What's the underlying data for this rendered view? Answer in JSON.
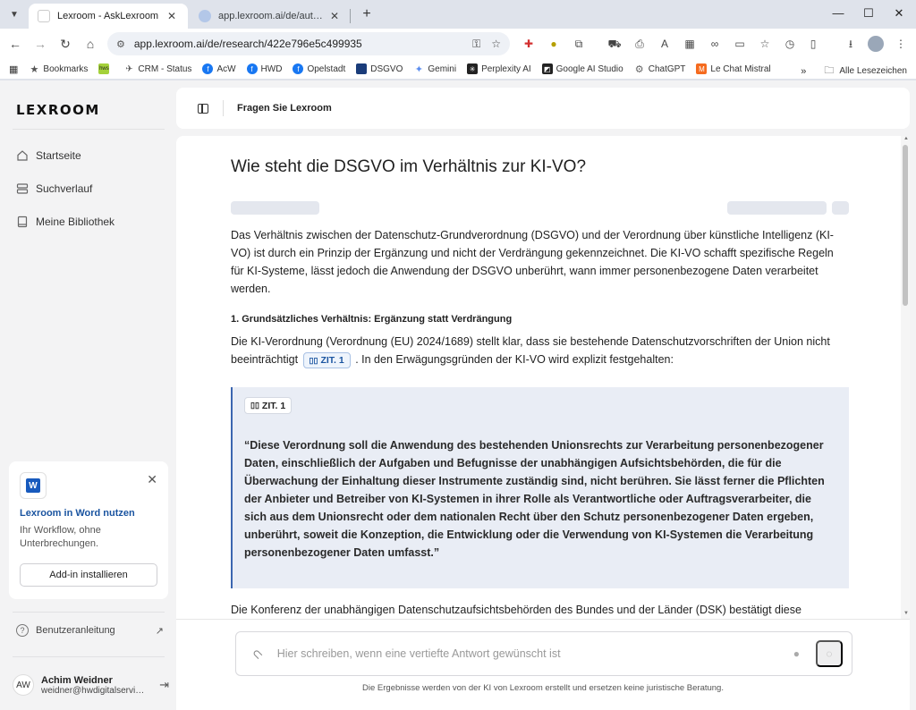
{
  "browser": {
    "tabs": [
      {
        "title": "Lexroom - AskLexroom",
        "close": "✕"
      },
      {
        "title": "app.lexroom.ai/de/auth/sign-up",
        "close": "✕"
      }
    ],
    "url": "app.lexroom.ai/de/research/422e796e5c499935",
    "bookmarks": [
      {
        "label": "Bookmarks",
        "icon": "star-icon",
        "color": "#555"
      },
      {
        "label": "",
        "icon": "hws-icon",
        "color": "#8bc34a"
      },
      {
        "label": "CRM - Status",
        "icon": "crm-icon",
        "color": "#555"
      },
      {
        "label": "AcW",
        "icon": "facebook-icon",
        "color": "#1877f2"
      },
      {
        "label": "HWD",
        "icon": "facebook-icon",
        "color": "#1877f2"
      },
      {
        "label": "Opelstadt",
        "icon": "facebook-icon",
        "color": "#1877f2"
      },
      {
        "label": "DSGVO",
        "icon": "dsgvo-icon",
        "color": "#1a3c7a"
      },
      {
        "label": "Gemini",
        "icon": "gemini-icon",
        "color": "#5b8def"
      },
      {
        "label": "Perplexity AI",
        "icon": "perplexity-icon",
        "color": "#222"
      },
      {
        "label": "Google AI Studio",
        "icon": "ai-studio-icon",
        "color": "#222"
      },
      {
        "label": "ChatGPT",
        "icon": "chatgpt-icon",
        "color": "#666"
      },
      {
        "label": "Le Chat Mistral",
        "icon": "mistral-icon",
        "color": "#f56b1f"
      }
    ],
    "all_bookmarks": "Alle Lesezeichen"
  },
  "sidebar": {
    "logo": "LEXROOM",
    "nav": [
      {
        "label": "Startseite",
        "icon": "home-icon"
      },
      {
        "label": "Suchverlauf",
        "icon": "history-icon"
      },
      {
        "label": "Meine Bibliothek",
        "icon": "library-icon"
      }
    ],
    "promo": {
      "title": "Lexroom in Word nutzen",
      "text": "Ihr Workflow, ohne Unterbrechungen.",
      "button": "Add-in installieren"
    },
    "help": "Benutzeranleitung",
    "user": {
      "initials": "AW",
      "name": "Achim Weidner",
      "email": "weidner@hwdigitalservices.de"
    }
  },
  "header": {
    "title": "Fragen Sie Lexroom"
  },
  "main": {
    "question": "Wie steht die DSGVO im Verhältnis zur KI-VO?",
    "intro": "Das Verhältnis zwischen der Datenschutz-Grundverordnung (DSGVO) und der Verordnung über künstliche Intelligenz (KI-VO) ist durch ein Prinzip der Ergänzung und nicht der Verdrängung gekennzeichnet. Die KI-VO schafft spezifische Regeln für KI-Systeme, lässt jedoch die Anwendung der DSGVO unberührt, wann immer personenbezogene Daten verarbeitet werden.",
    "section1_heading": "1. Grundsätzliches Verhältnis: Ergänzung statt Verdrängung",
    "section1_text_a": "Die KI-Verordnung (Verordnung (EU) 2024/1689) stellt klar, dass sie bestehende Datenschutzvorschriften der Union nicht beeinträchtigt",
    "citation_label": "ZIT. 1",
    "section1_text_b": ". In den Erwägungsgründen der KI-VO wird explizit festgehalten:",
    "quote": "“Diese Verordnung soll die Anwendung des bestehenden Unionsrechts zur Verarbeitung personenbezogener Daten, einschließlich der Aufgaben und Befugnisse der unabhängigen Aufsichtsbehörden, die für die Überwachung der Einhaltung dieser Instrumente zuständig sind, nicht berühren. Sie lässt ferner die Pflichten der Anbieter und Betreiber von KI-Systemen in ihrer Rolle als Verantwortliche oder Auftragsverarbeiter, die sich aus dem Unionsrecht oder dem nationalen Recht über den Schutz personenbezogener Daten ergeben, unberührt, soweit die Konzeption, die Entwicklung oder die Verwendung von KI-Systemen die Verarbeitung personenbezogener Daten umfasst.”",
    "next_para": "Die Konferenz der unabhängigen Datenschutzaufsichtsbehörden des Bundes und der Länder (DSK) bestätigt diese"
  },
  "composer": {
    "placeholder": "Hier schreiben, wenn eine vertiefte Antwort gewünscht ist",
    "disclaimer": "Die Ergebnisse werden von der KI von Lexroom erstellt und ersetzen keine juristische Beratung."
  },
  "colors": {
    "accent": "#1a54a0",
    "quote_bg": "#e9edf5",
    "quote_border": "#3b66b0"
  }
}
